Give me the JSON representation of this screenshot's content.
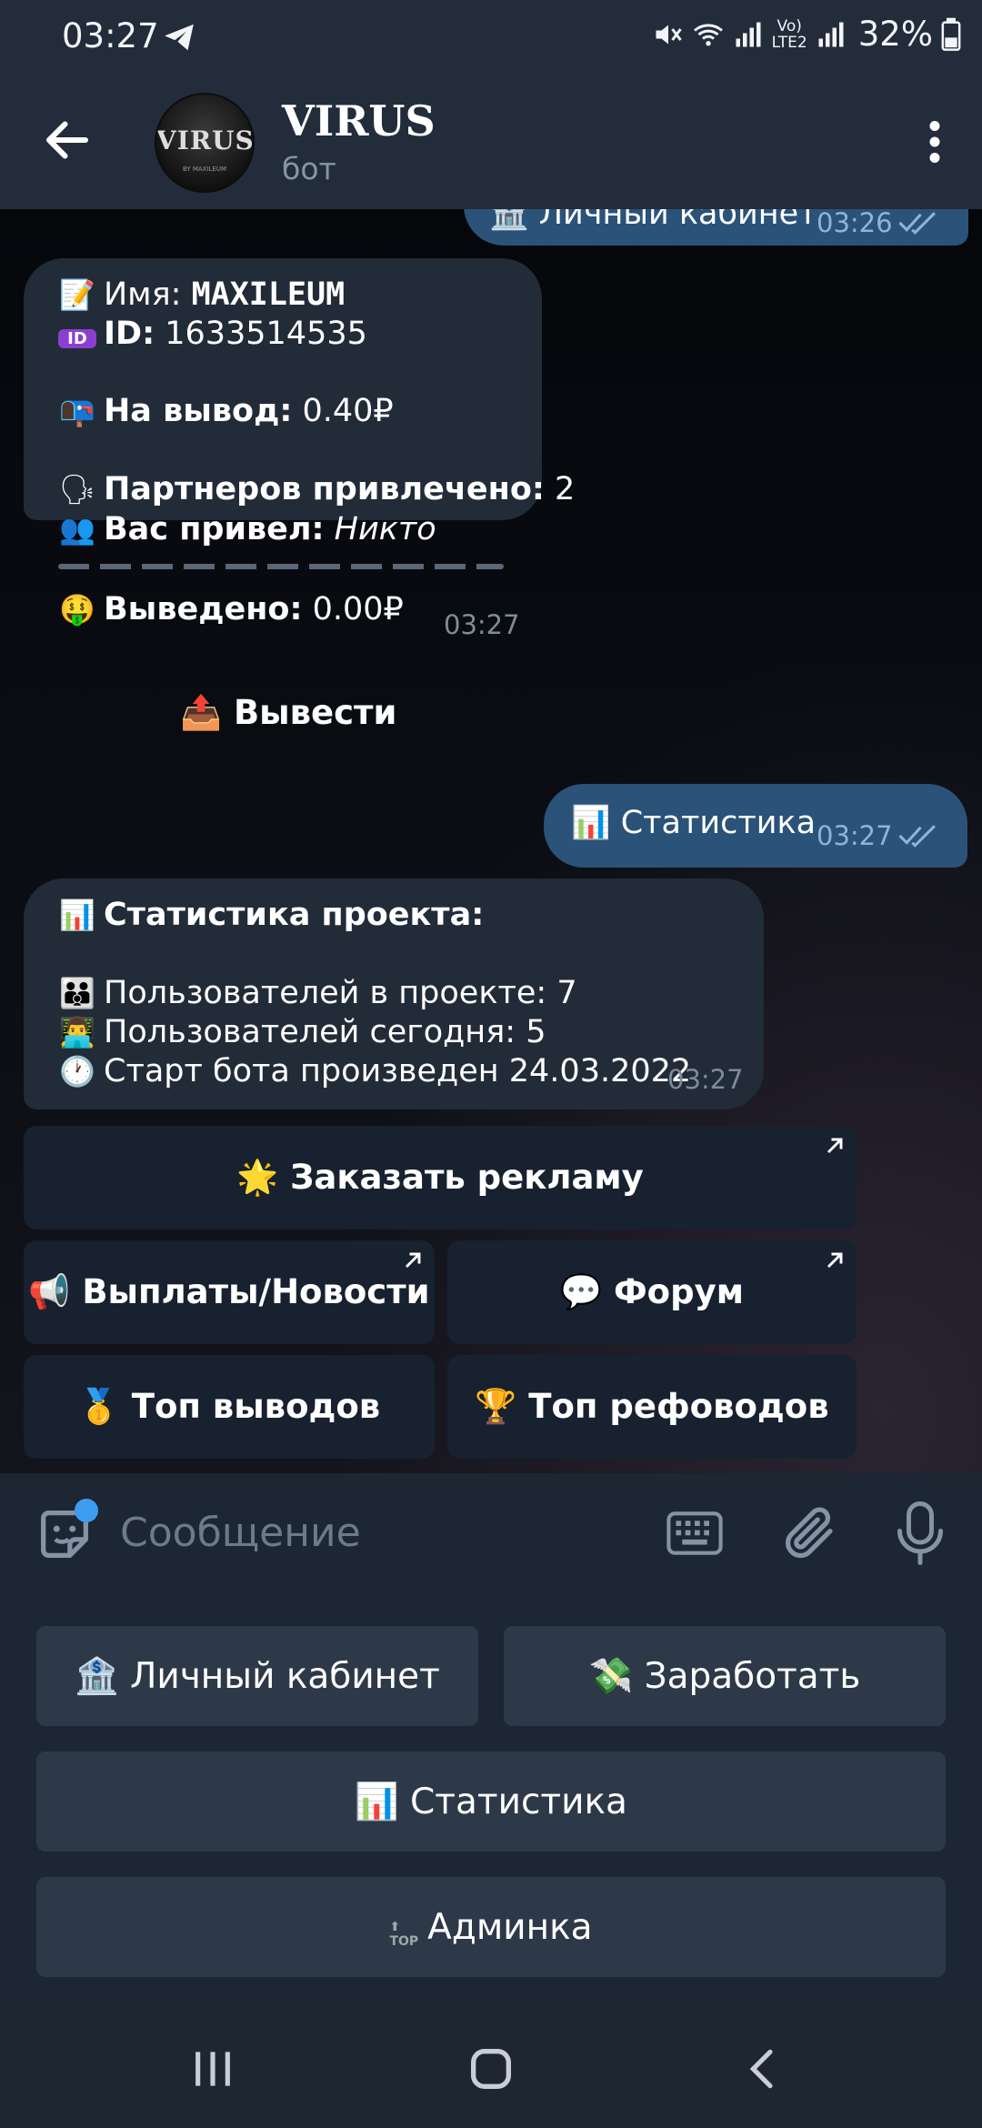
{
  "status": {
    "time": "03:27",
    "battery": "32%",
    "network_label": "LTE2"
  },
  "header": {
    "title": "VIRUS",
    "subtitle": "бот",
    "avatar_text": "VIRUS",
    "avatar_sub": "BY MAXILEUM"
  },
  "messages": {
    "prev_out": {
      "text": "🏦 Личный кабинет",
      "time": "03:26"
    },
    "profile": {
      "name_label": "Имя:",
      "name_value": "MAXILEUM",
      "id_label": "ID:",
      "id_value": "1633514535",
      "withdraw_label": "На вывод:",
      "withdraw_value": "0.40₽",
      "partners_label": "Партнеров привлечено:",
      "partners_value": "2",
      "referrer_label": "Вас привел:",
      "referrer_value": "Никто",
      "withdrawn_label": "Выведено:",
      "withdrawn_value": "0.00₽",
      "time": "03:27"
    },
    "withdraw_button": "📤 Вывести",
    "stats_out": {
      "text": "📊 Статистика",
      "time": "03:27"
    },
    "stats": {
      "title": "Статистика проекта:",
      "users_total_label": "Пользователей в проекте:",
      "users_total_value": "7",
      "users_today_label": "Пользователей сегодня:",
      "users_today_value": "5",
      "start_label": "Старт бота произведен",
      "start_value": "24.03.2022",
      "time": "03:27"
    }
  },
  "inline_buttons": {
    "ads": "🌟 Заказать рекламу",
    "payouts": "📢 Выплаты/Новости",
    "forum": "💬 Форум",
    "top_withdrawals": "🥇 Топ выводов",
    "top_referrers": "🏆 Топ рефоводов"
  },
  "input": {
    "placeholder": "Сообщение"
  },
  "reply_keyboard": {
    "cabinet": "🏦 Личный кабинет",
    "earn": "💸 Заработать",
    "stats": "📊 Статистика",
    "admin": "Админка",
    "admin_badge": "TOP"
  },
  "colors": {
    "header_bg": "#222c3a",
    "outgoing_bubble": "#2b5278",
    "incoming_bubble": "#222b38",
    "keyboard_button": "#2d3948",
    "accent": "#3e9cf0"
  }
}
